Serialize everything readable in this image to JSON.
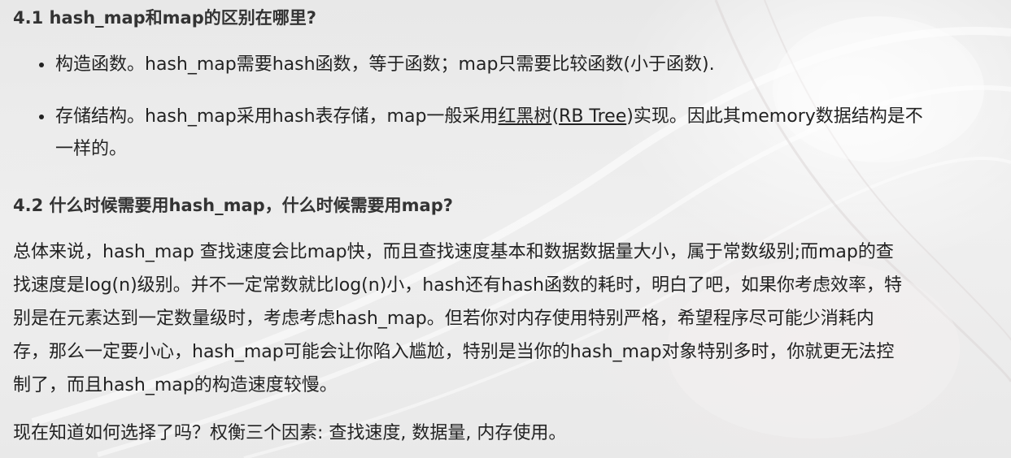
{
  "section_1": {
    "title": "4.1 hash_map和map的区别在哪里?",
    "bullets": [
      {
        "text": "构造函数。hash_map需要hash函数，等于函数；map只需要比较函数(小于函数)."
      },
      {
        "text_before": "存储结构。hash_map采用hash表存储，map一般采用",
        "link_1": "红黑树",
        "paren_open": "(",
        "link_2": "RB Tree",
        "text_after_line1": ")实现。因此其memory数据结构是不",
        "text_line2": "一样的。"
      }
    ]
  },
  "section_2": {
    "title": "4.2 什么时候需要用hash_map，什么时候需要用map?",
    "paragraph_lines": [
      "总体来说，hash_map 查找速度会比map快，而且查找速度基本和数据数据量大小，属于常数级别;而map的查",
      "找速度是log(n)级别。并不一定常数就比log(n)小，hash还有hash函数的耗时，明白了吧，如果你考虑效率，特",
      "别是在元素达到一定数量级时，考虑考虑hash_map。但若你对内存使用特别严格，希望程序尽可能少消耗内",
      "存，那么一定要小心，hash_map可能会让你陷入尴尬，特别是当你的hash_map对象特别多时，你就更无法控",
      "制了，而且hash_map的构造速度较慢。"
    ],
    "summary": "现在知道如何选择了吗？权衡三个因素: 查找速度, 数据量, 内存使用。"
  }
}
